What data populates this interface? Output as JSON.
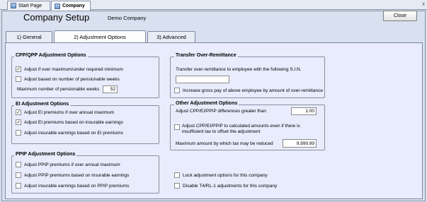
{
  "doc_tabs": [
    {
      "label": "Start Page"
    },
    {
      "label": "Company"
    }
  ],
  "close_mark": "x",
  "header": {
    "title": "Company Setup",
    "company_name": "Demo Company",
    "close_label": "Close"
  },
  "tabs": [
    {
      "label": "1) General"
    },
    {
      "label": "2) Adjustment Options"
    },
    {
      "label": "3) Advanced"
    }
  ],
  "cpp": {
    "title": "CPP/QPP Adjustment Options",
    "opt1": "Adjust if over maximum/under required minimum",
    "opt2": "Adjust based on number of pensionable weeks",
    "max_weeks_label": "Maximum number of pensionable weeks",
    "max_weeks_value": "52"
  },
  "ei": {
    "title": "EI Adjustment Options",
    "opt1": "Adjust EI premiums if over annual maximum",
    "opt2": "Adjust EI premiums based on insurable earnings",
    "opt3": "Adjust insurable earnings based on EI premiums"
  },
  "ppip": {
    "title": "PPIP Adjustment Options",
    "opt1": "Adjust PPIP premiums if over annual maximum",
    "opt2": "Adjust PPIP premiums based on insurable earnings",
    "opt3": "Adjust insurable earnings based on PPIP premiums"
  },
  "transfer": {
    "title": "Transfer Over-Remittance",
    "label": "Transfer over-remittance to employee with the following S.I.N.",
    "sin_value": "",
    "opt": "Increase gross pay of above employee by amount of over-remittance"
  },
  "other": {
    "title": "Other Adjustment Options",
    "diff_label": "Adjust CPP/EI/PPIP differences greater than",
    "diff_value": "1.00",
    "opt_line1": "Adjust CPP/EI/PPIP to calculated amounts even if there is",
    "opt_line2": "insufficient tax to offset the adjustment",
    "max_label": "Maximum amount by which tax may be reduced",
    "max_value": "9,999.99"
  },
  "lock_label": "Lock adjustment options for this company",
  "disable_label": "Disable T4/RL-1 adjustments for this company",
  "check_mark": "✓"
}
